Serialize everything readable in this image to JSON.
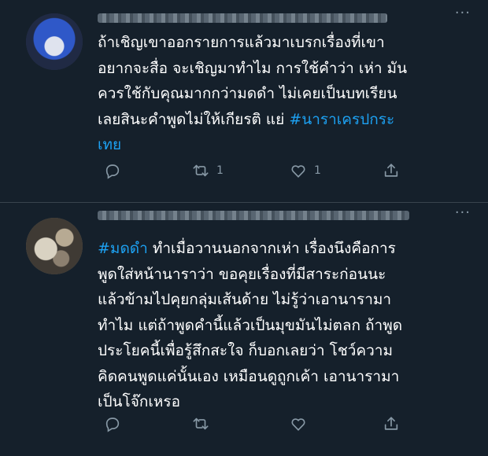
{
  "tweets": [
    {
      "lines": [
        [
          {
            "t": "ถ้าเชิญเขาออกรายการแล้วมาเบรกเรื่องที่เขา"
          }
        ],
        [
          {
            "t": "อยากจะสื่อ จะเชิญมาทำไม การใช้คำว่า เห่า  มัน"
          }
        ],
        [
          {
            "t": "ควรใช้กับคุณมากกว่ามดดำ  ไม่เคยเป็นบทเรียน"
          }
        ],
        [
          {
            "t": "เลยสินะคำพูดไม่ให้เกียรติ แย่ "
          },
          {
            "t": "#นาราเครปกระ",
            "h": true
          }
        ],
        [
          {
            "t": "เทย",
            "h": true
          }
        ]
      ],
      "retweets": "1",
      "likes": "1"
    },
    {
      "lines": [
        [
          {
            "t": "#มดดำ",
            "h": true
          },
          {
            "t": " ทำเมื่อวานนอกจากเห่า เรื่องนึงคือการ"
          }
        ],
        [
          {
            "t": "พูดใส่หน้านาราว่า ขอคุยเรื่องที่มีสาระก่อนนะ"
          }
        ],
        [
          {
            "t": "แล้วข้ามไปคุยกลุ่มเส้นด้าย  ไม่รู้ว่าเอานารามา"
          }
        ],
        [
          {
            "t": "ทำไม แต่ถ้าพูดคำนี้แล้วเป็นมุขมันไม่ตลก ถ้าพูด"
          }
        ],
        [
          {
            "t": "ประโยคนี้เพื่อรู้สึกสะใจ ก็บอกเลยว่า โชว์ความ"
          }
        ],
        [
          {
            "t": "คิดคนพูดแค่นั้นเอง เหมือนดูถูกเค้า เอานารามา"
          }
        ],
        [
          {
            "t": "เป็นโจ๊กเหรอ"
          }
        ]
      ],
      "retweets": "",
      "likes": ""
    }
  ],
  "colors": {
    "background": "#15202b",
    "divider": "#38444d",
    "hashtag": "#1da1f2",
    "icon": "#8899a6"
  },
  "icons": [
    "reply-icon",
    "retweet-icon",
    "like-icon",
    "share-icon",
    "more-icon"
  ]
}
